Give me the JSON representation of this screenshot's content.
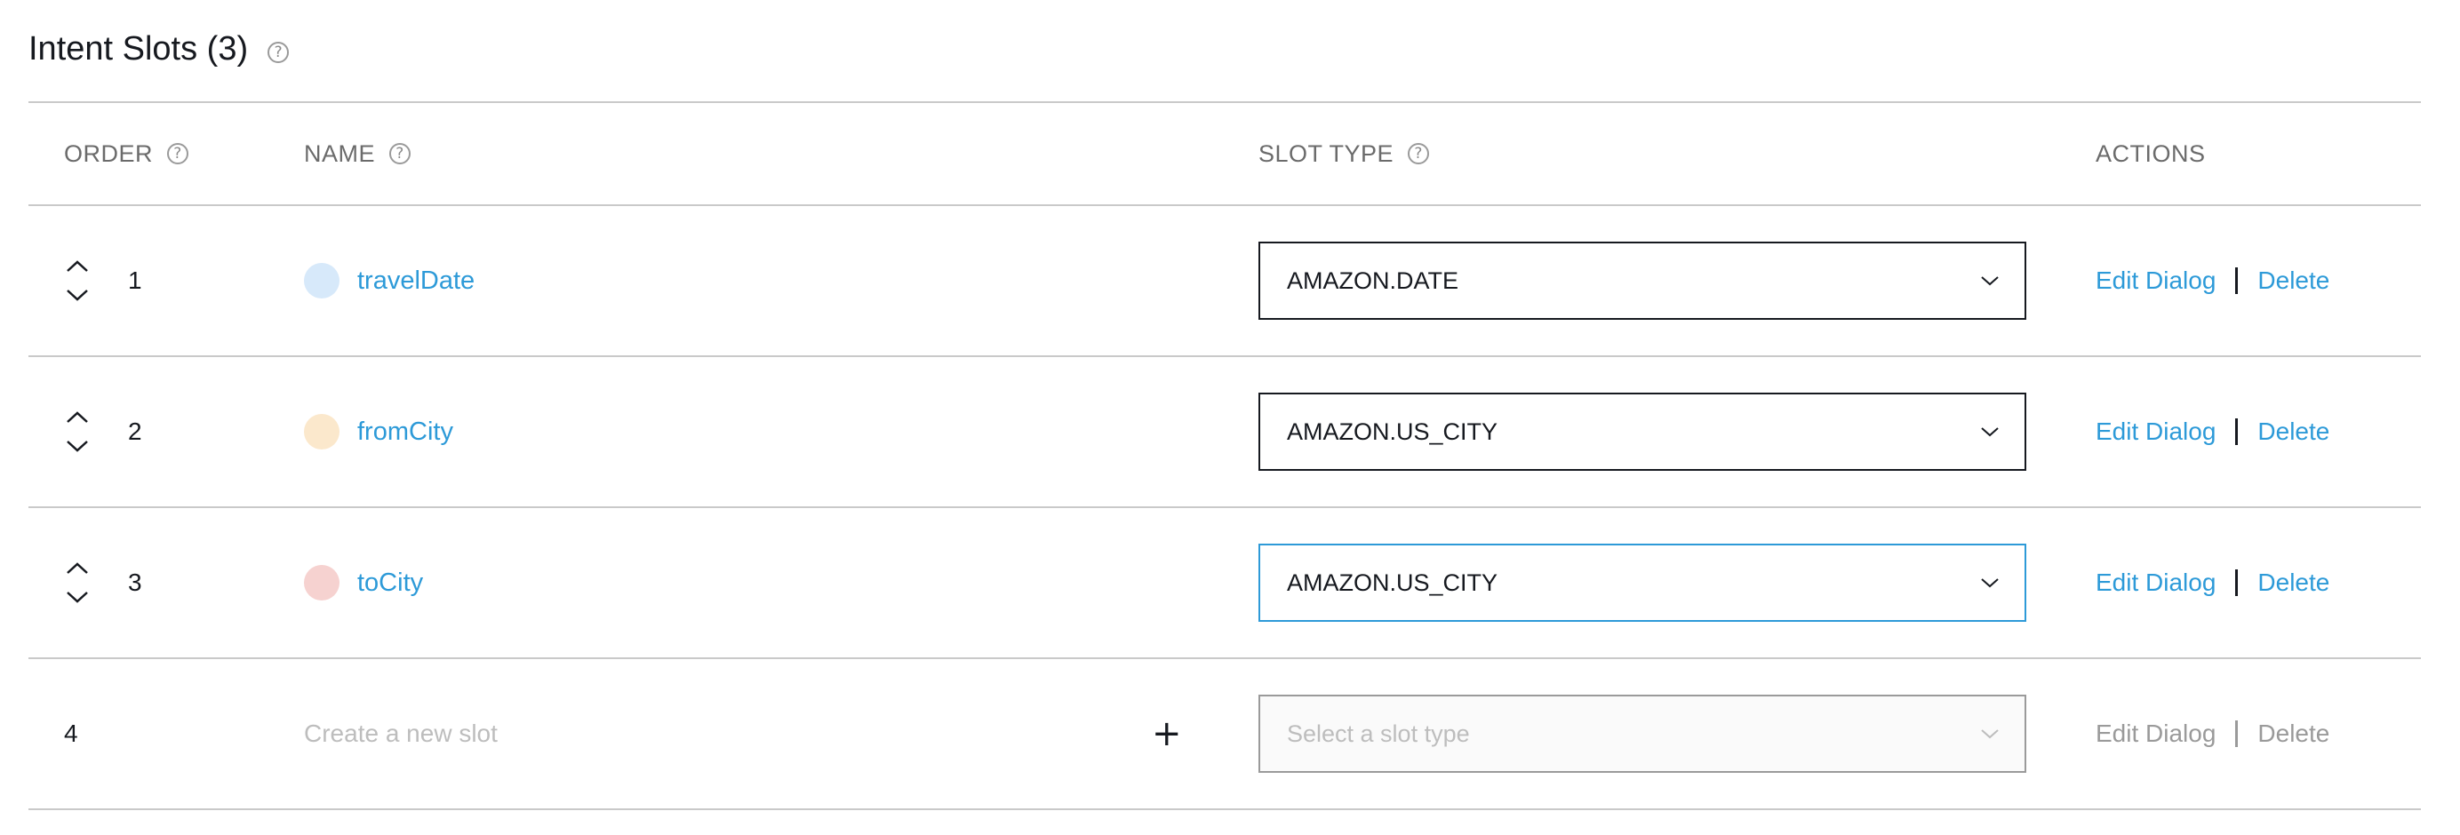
{
  "title": "Intent Slots (3)",
  "help_glyph": "?",
  "columns": {
    "order": "ORDER",
    "name": "NAME",
    "slot_type": "SLOT TYPE",
    "actions": "ACTIONS"
  },
  "slots": [
    {
      "order": "1",
      "name": "travelDate",
      "dot_color": "#d7e9fa",
      "slot_type": "AMAZON.DATE",
      "focused": false
    },
    {
      "order": "2",
      "name": "fromCity",
      "dot_color": "#fbe8cc",
      "slot_type": "AMAZON.US_CITY",
      "focused": false
    },
    {
      "order": "3",
      "name": "toCity",
      "dot_color": "#f6d2d0",
      "slot_type": "AMAZON.US_CITY",
      "focused": true
    }
  ],
  "new_slot": {
    "order": "4",
    "placeholder": "Create a new slot",
    "plus": "+",
    "slot_type_placeholder": "Select a slot type"
  },
  "actions": {
    "edit": "Edit Dialog",
    "delete": "Delete"
  },
  "colors": {
    "link": "#2d9ad8",
    "border": "#c9c9c9",
    "text": "#16191f"
  }
}
